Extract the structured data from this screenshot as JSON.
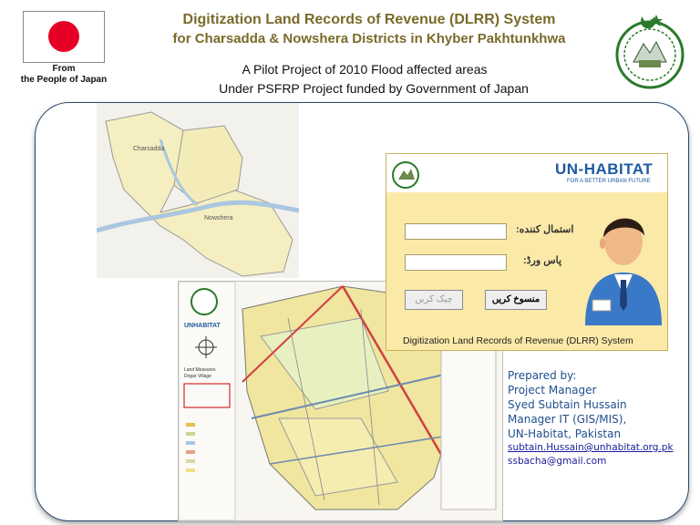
{
  "header": {
    "title_line1": "Digitization Land Records of Revenue (DLRR) System",
    "title_line2": "for Charsadda & Nowshera Districts in Khyber Pakhtunkhwa",
    "subtitle_line1": "A Pilot Project of 2010 Flood affected areas",
    "subtitle_line2": "Under PSFRP Project funded by Government of Japan"
  },
  "donor": {
    "line1": "From",
    "line2": "the People of Japan"
  },
  "map_overview": {
    "label1": "Charsadda",
    "label2": "Nowshera"
  },
  "login_panel": {
    "brand": "UN-HABITAT",
    "brand_tagline": "FOR A BETTER URBAN FUTURE",
    "username_label": "استمال کننده:",
    "password_label": "پاس ورڈ:",
    "login_button": "چیک کریں",
    "cancel_button": "منسوخ کریں",
    "footer": "Digitization Land Records of Revenue (DLRR) System"
  },
  "cadastral_map": {
    "org_label": "UNHABITAT",
    "village_label_1": "Land Measures",
    "village_label_2": "Dogar Village"
  },
  "prepared_by": {
    "heading": "Prepared by:",
    "role": "Project Manager",
    "name": "Syed Subtain Hussain",
    "title": "Manager IT (GIS/MIS),",
    "org": "UN-Habitat, Pakistan",
    "email1": "subtain.Hussain@unhabitat.org.pk",
    "email2": "ssbacha@gmail.com"
  },
  "colors": {
    "title": "#7a6a2a",
    "frame": "#27496d",
    "accent_blue": "#1f4e8c",
    "japan_red": "#e60026"
  }
}
